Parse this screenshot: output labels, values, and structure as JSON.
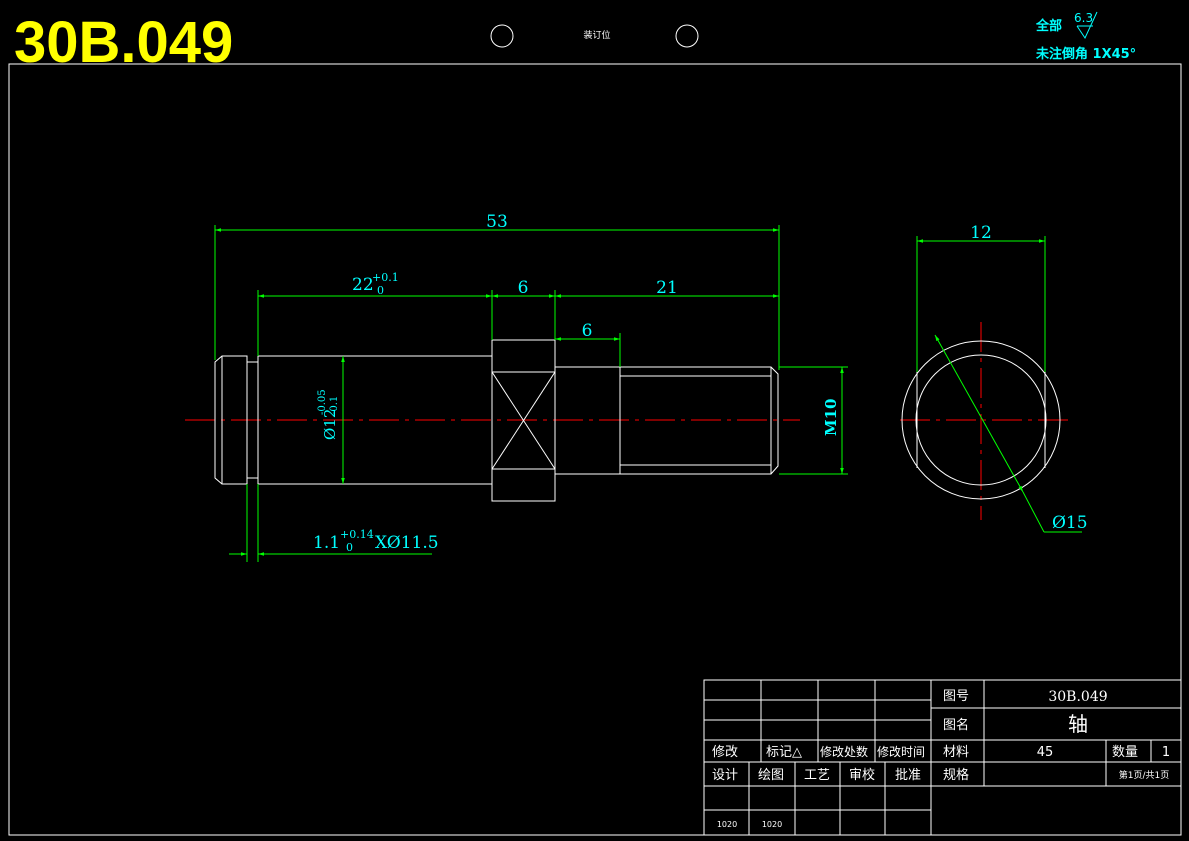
{
  "drawing_number_big": "30B.049",
  "binding_label": "装订位",
  "roughness": {
    "prefix": "全部",
    "value": "6.3",
    "chamfer_note": "未注倒角 1X45°"
  },
  "dimensions": {
    "overall": "53",
    "section_a": "22",
    "section_a_tol_upper": "+0.1",
    "section_a_tol_lower": "0",
    "collar": "6",
    "thread_part": "21",
    "relief": "6",
    "dia_main": "Ø12",
    "dia_main_tol_upper": "-0.05",
    "dia_main_tol_lower": "-0.1",
    "thread": "M10",
    "groove_base": "1.1",
    "groove_tol_upper": "+0.14",
    "groove_tol_lower": "0",
    "groove_suffix": "XØ11.5",
    "end_view_width": "12",
    "end_view_dia": "Ø15"
  },
  "title_block": {
    "rev_headers": [
      "修改",
      "标记△",
      "修改处数",
      "修改时间"
    ],
    "sign_headers": [
      "设计",
      "绘图",
      "工艺",
      "审校",
      "批准"
    ],
    "sign_values": [
      "1020",
      "1020"
    ],
    "drawing_no_label": "图号",
    "drawing_no": "30B.049",
    "name_label": "图名",
    "name": "轴",
    "material_label": "材料",
    "material": "45",
    "quantity_label": "数量",
    "quantity": "1",
    "spec_label": "规格",
    "page_info": "第1页/共1页"
  },
  "colors": {
    "outline": "#ffffff",
    "dimension": "#00ff00",
    "dim_text": "#00ffff",
    "centerline": "#ff0000",
    "title": "#ffff00"
  }
}
